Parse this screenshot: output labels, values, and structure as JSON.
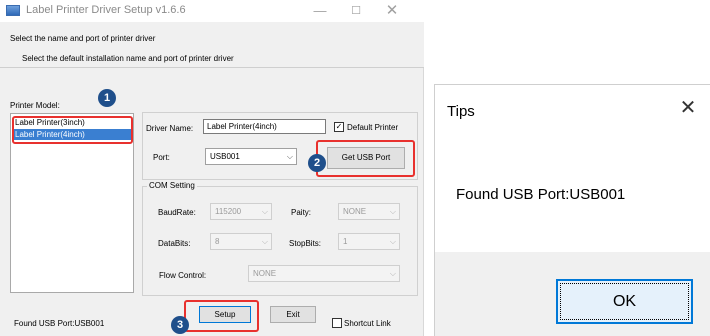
{
  "window": {
    "title": "Label Printer Driver Setup v1.6.6",
    "minimize_glyph": "—",
    "maximize_glyph": "☐",
    "close_glyph": "✕",
    "header_line1": "Select the name and port of printer driver",
    "header_line2": "Select the default installation name and port of printer driver"
  },
  "printer_model": {
    "label": "Printer Model:",
    "items": [
      "Label Printer(3inch)",
      "Label Printer(4inch)"
    ],
    "selected_index": 1
  },
  "driver": {
    "name_label": "Driver Name:",
    "name_value": "Label Printer(4inch)",
    "default_printer_label": "Default Printer",
    "default_printer_checked": true,
    "port_label": "Port:",
    "port_value": "USB001",
    "get_usb_port_label": "Get USB Port"
  },
  "com_setting": {
    "group_label": "COM Setting",
    "baudrate_label": "BaudRate:",
    "baudrate_value": "115200",
    "parity_label": "Paity:",
    "parity_value": "NONE",
    "databits_label": "DataBits:",
    "databits_value": "8",
    "stopbits_label": "StopBits:",
    "stopbits_value": "1",
    "flow_control_label": "Flow Control:",
    "flow_control_value": "NONE"
  },
  "footer": {
    "status_text": "Found USB Port:USB001",
    "setup_label": "Setup",
    "exit_label": "Exit",
    "shortcut_label": "Shortcut Link",
    "shortcut_checked": false
  },
  "annotations": {
    "badge_1": "1",
    "badge_2": "2",
    "badge_3": "3",
    "highlight_color": "#e8312e",
    "badge_color": "#1f4f8b"
  },
  "tips": {
    "title": "Tips",
    "close_glyph": "✕",
    "message": "Found USB Port:USB001",
    "ok_label": "OK"
  }
}
